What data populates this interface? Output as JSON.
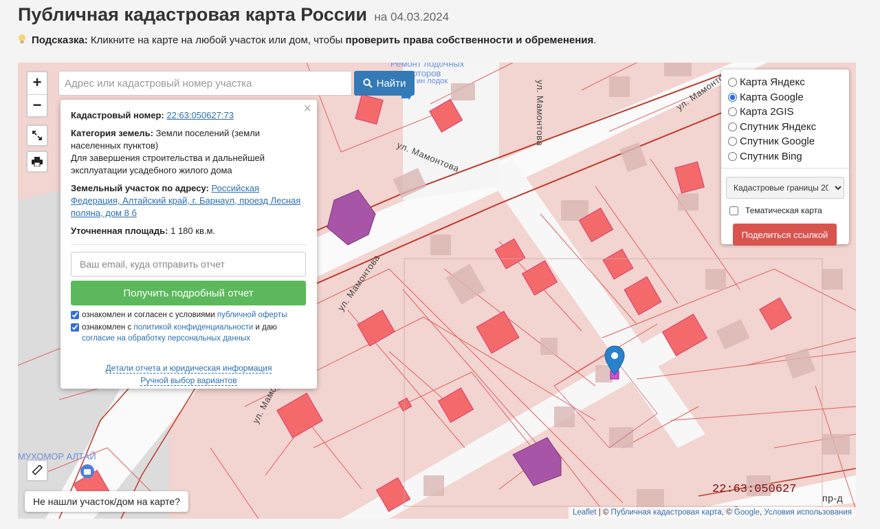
{
  "header": {
    "title": "Публичная кадастровая карта России",
    "date": "на 04.03.2024"
  },
  "hint": {
    "label": "Подсказка:",
    "text": "Кликните на карте на любой участок или дом, чтобы",
    "emphasis": "проверить права собственности и обременения",
    "end": "."
  },
  "search": {
    "placeholder": "Адрес или кадастровый номер участка",
    "button": "Найти"
  },
  "zoom": {
    "in": "+",
    "out": "−"
  },
  "popup": {
    "close": "×",
    "cad_label": "Кадастровый номер:",
    "cad_value": "22:63:050627:73",
    "category_label": "Категория земель:",
    "category_value": "Земли поселений (земли населенных пунктов)",
    "purpose": "Для завершения строительства и дальнейшей эксплуатации усадебного жилого дома",
    "address_label": "Земельный участок по адресу:",
    "address_value": "Российская Федерация, Алтайский край, г. Барнаул, проезд Лесная поляна, дом 8 б",
    "area_label": "Уточненная площадь:",
    "area_value": "1 180 кв.м.",
    "email_placeholder": "Ваш email, куда отправить отчет",
    "report_button": "Получить подробный отчет",
    "consent1_text": "ознакомлен и согласен с условиями",
    "consent1_link": "публичной оферты",
    "consent2_text": "ознакомлен с",
    "consent2_link": "политикой конфиденциальности",
    "consent2_mid": "и даю",
    "consent2_link2": "согласие на обработку персональных данных",
    "details_link": "Детали отчета и юридическая информация",
    "manual_link": "Ручной выбор вариантов"
  },
  "layers": {
    "options": [
      {
        "label": "Карта Яндекс",
        "selected": false
      },
      {
        "label": "Карта Google",
        "selected": true
      },
      {
        "label": "Карта 2GIS",
        "selected": false
      },
      {
        "label": "Спутник Яндекс",
        "selected": false
      },
      {
        "label": "Спутник Google",
        "selected": false
      },
      {
        "label": "Спутник Bing",
        "selected": false
      }
    ],
    "select_value": "Кадастровые границы 20",
    "thematic": "Тематическая карта",
    "share_button": "Поделиться ссылкой"
  },
  "map": {
    "streets": [
      "ул. Мамонтова",
      "ул. Мамонтова",
      "ул. Мамонтова",
      "ул. Мамонтова",
      "ул. Мамонтова"
    ],
    "poi1": "Ремонт лодочных",
    "poi1b": "моторов",
    "poi1c": "ин лодок",
    "poi2": "МУХОМОР АЛТАЙ",
    "cad_quarter": "22:63:050627",
    "not_found": "Не нашли участок/дом на карте?",
    "street_right": "пр-д",
    "street_right2": "сляна",
    "colors": {
      "parcel_fill": "#f2d4d0",
      "building": "#f46a6a",
      "road_red": "#c0392b",
      "purple": "#a855a8"
    }
  },
  "attribution": {
    "leaflet": "Leaflet",
    "sep1": " | © ",
    "pkk": "Публичная кадастровая карта",
    "sep2": ", © ",
    "google": "Google",
    "sep3": ", ",
    "terms": "Условия использования"
  }
}
